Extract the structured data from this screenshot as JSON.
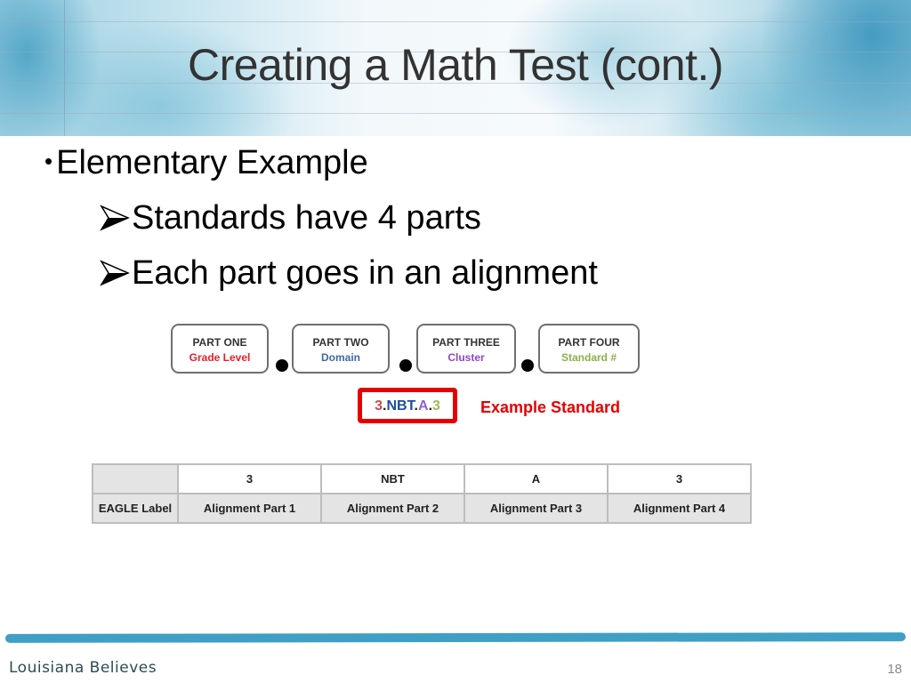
{
  "slide": {
    "title": "Creating a Math Test (cont.)",
    "bullets": {
      "level1": "Elementary Example",
      "level2": [
        "Standards have 4 parts",
        "Each part goes in an alignment"
      ]
    },
    "parts": [
      {
        "title": "PART ONE",
        "subtitle": "Grade Level",
        "color": "#e8202a"
      },
      {
        "title": "PART TWO",
        "subtitle": "Domain",
        "color": "#3d6aa8"
      },
      {
        "title": "PART THREE",
        "subtitle": "Cluster",
        "color": "#8a48c8"
      },
      {
        "title": "PART FOUR",
        "subtitle": "Standard #",
        "color": "#8ab04a"
      }
    ],
    "example": {
      "segments": [
        {
          "text": "3",
          "color": "#c0504d"
        },
        {
          "text": ".",
          "color": "#222222"
        },
        {
          "text": "NBT",
          "color": "#1f4e9c"
        },
        {
          "text": ".",
          "color": "#222222"
        },
        {
          "text": "A",
          "color": "#8a68c8"
        },
        {
          "text": ".",
          "color": "#222222"
        },
        {
          "text": "3",
          "color": "#9bbb59"
        }
      ],
      "label": "Example Standard",
      "border_color": "#e60000"
    },
    "table": {
      "row1": [
        "",
        "3",
        "NBT",
        "A",
        "3"
      ],
      "row2": [
        "EAGLE Label",
        "Alignment Part 1",
        "Alignment Part 2",
        "Alignment Part 3",
        "Alignment Part 4"
      ]
    },
    "footer": {
      "brand": "Louisiana Believes",
      "page_number": "18",
      "accent": "#3f9fc5"
    }
  }
}
